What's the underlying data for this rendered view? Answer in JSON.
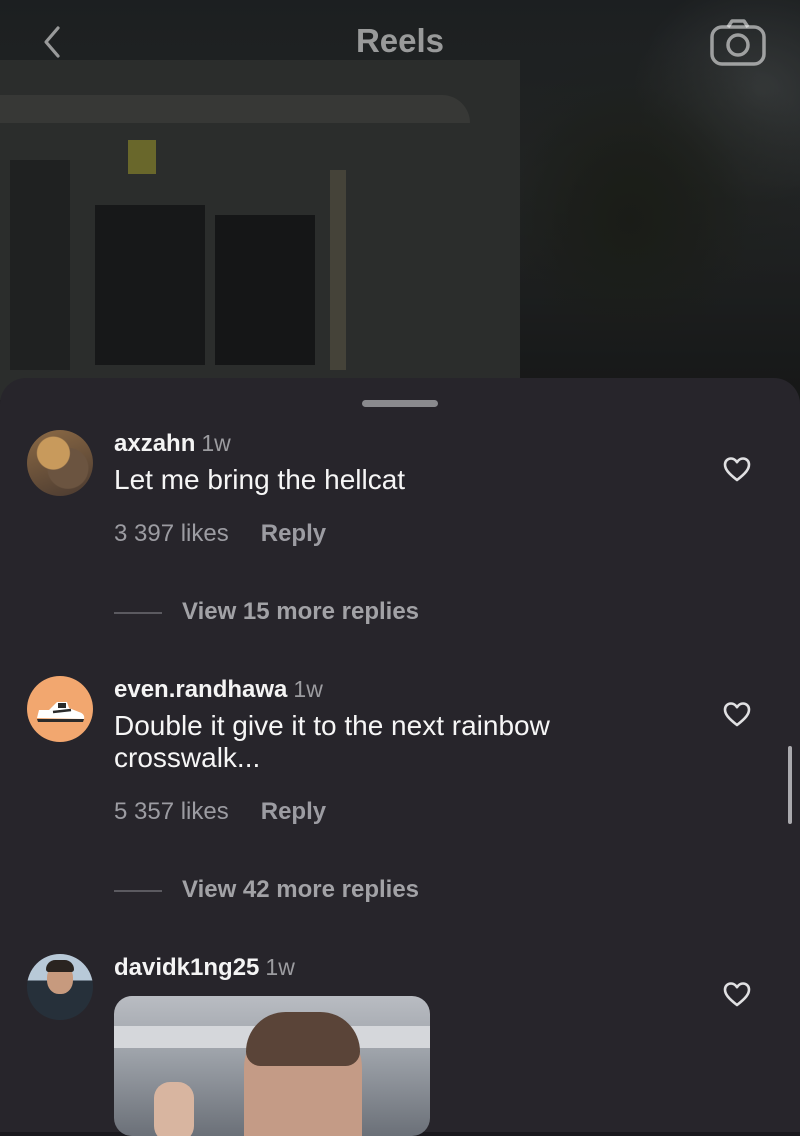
{
  "header": {
    "title": "Reels"
  },
  "comments": [
    {
      "username": "axzahn",
      "time": "1w",
      "text": "Let me bring the hellcat",
      "likes": "3 397 likes",
      "reply_label": "Reply",
      "view_more": "View 15 more replies"
    },
    {
      "username": "even.randhawa",
      "time": "1w",
      "text": "Double it give it to the next rainbow crosswalk...",
      "likes": "5 357 likes",
      "reply_label": "Reply",
      "view_more": "View 42 more replies"
    },
    {
      "username": "davidk1ng25",
      "time": "1w",
      "attachment": "gif"
    }
  ],
  "icons": {
    "back": "chevron-left-icon",
    "camera": "camera-icon",
    "like": "heart-outline-icon"
  },
  "colors": {
    "sheet_background": "#27252b",
    "secondary_text": "#9c9ca2",
    "avatar_orange": "#f2a76f"
  }
}
